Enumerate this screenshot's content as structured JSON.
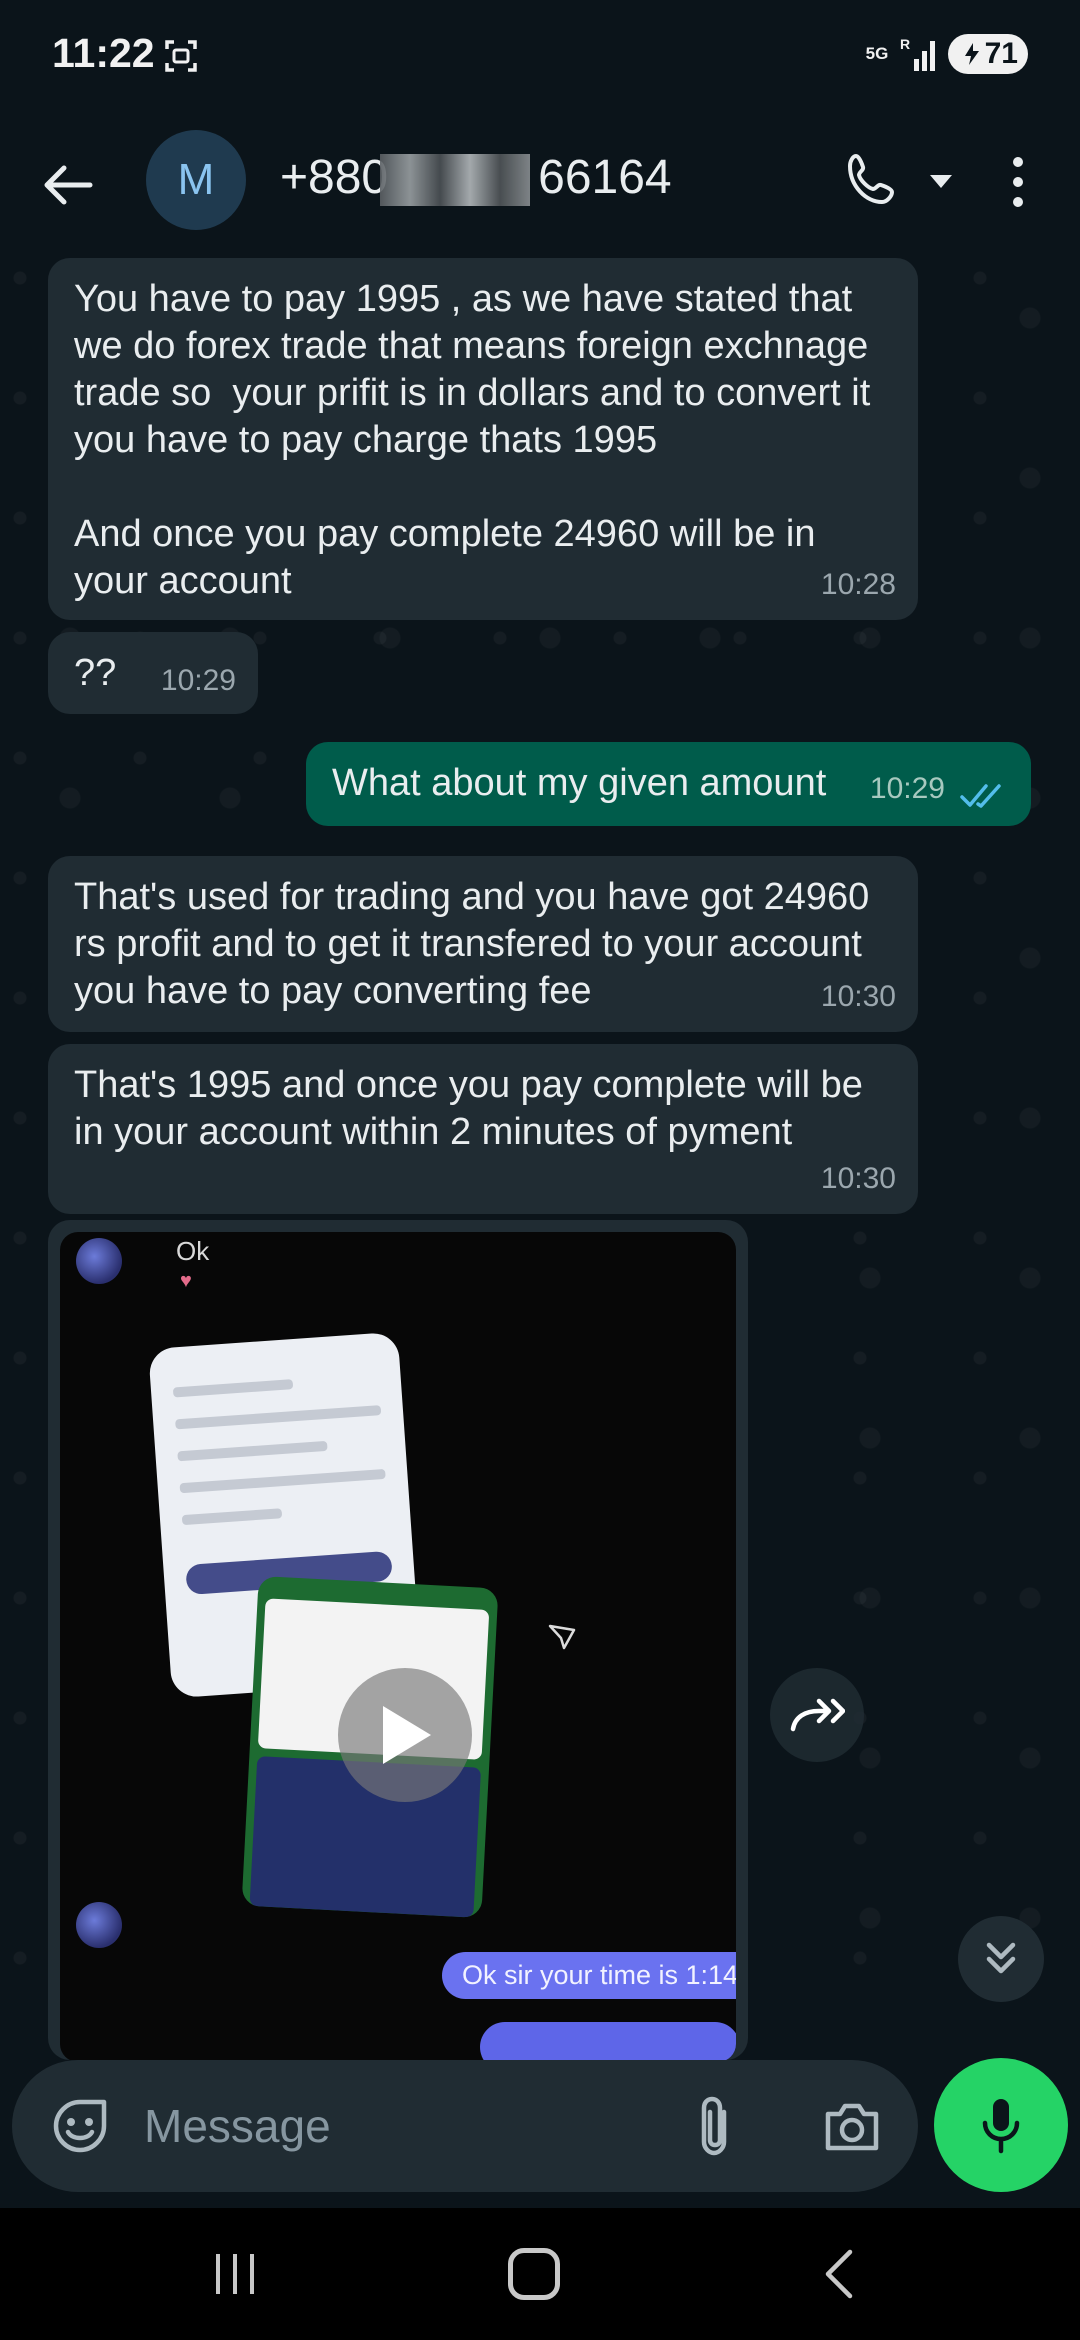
{
  "status_bar": {
    "time": "11:22",
    "network": "5G",
    "battery": "71"
  },
  "header": {
    "avatar_letter": "M",
    "contact_prefix": "+880",
    "contact_suffix": "66164"
  },
  "messages": [
    {
      "direction": "incoming",
      "text": "You have to pay 1995 , as we have stated that we do forex trade that means foreign exchnage trade so  your prifit is in dollars and to convert it you have to pay charge thats 1995\n\nAnd once you pay complete 24960 will be in your account",
      "time": "10:28"
    },
    {
      "direction": "incoming",
      "text": "??",
      "time": "10:29"
    },
    {
      "direction": "outgoing",
      "text": "What about my given amount",
      "time": "10:29",
      "status": "read"
    },
    {
      "direction": "incoming",
      "text": "That's used for trading and you have got 24960 rs profit and to get it transfered to your account you have to pay converting fee",
      "time": "10:30"
    },
    {
      "direction": "incoming",
      "text": "That's 1995 and once you pay complete will be in your account within 2 minutes of pyment",
      "time": "10:30"
    }
  ],
  "video_message": {
    "overlay_top_text": "Ok",
    "overlay_chat_text": "Ok sir your time is 1:14"
  },
  "composer": {
    "placeholder": "Message"
  },
  "colors": {
    "background": "#0b141a",
    "incoming_bubble": "#202c33",
    "outgoing_bubble": "#005c4b",
    "read_ticks": "#53bdeb",
    "mic_button": "#25d366"
  },
  "icons": [
    "screenshot-icon",
    "signal-icon",
    "back-arrow-icon",
    "call-icon",
    "caret-down-icon",
    "more-vert-icon",
    "double-check-icon",
    "play-icon",
    "forward-icon",
    "scroll-down-icon",
    "emoji-icon",
    "attach-icon",
    "camera-icon",
    "mic-icon",
    "nav-recent-icon",
    "nav-home-icon",
    "nav-back-icon"
  ]
}
